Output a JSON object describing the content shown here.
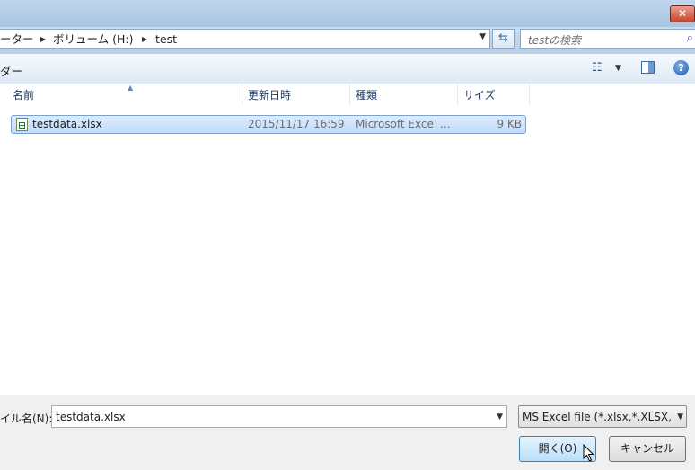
{
  "window": {
    "close_label": "✕"
  },
  "address": {
    "breadcrumbs": [
      "ーター",
      "ボリューム (H:)",
      "test"
    ],
    "search_placeholder": "testの検索"
  },
  "toolbar": {
    "label": "ダー"
  },
  "file_list": {
    "columns": [
      "名前",
      "更新日時",
      "種類",
      "サイズ"
    ],
    "rows": [
      {
        "name": "testdata.xlsx",
        "modified": "2015/11/17 16:59",
        "type": "Microsoft Excel ...",
        "size": "9 KB",
        "icon": "excel-file-icon"
      }
    ]
  },
  "bottom": {
    "filename_label": "イル名(N):",
    "filename_value": "testdata.xlsx",
    "filetype_value": "MS Excel file (*.xlsx,*.XLSX,",
    "open_label": "開く(O)",
    "cancel_label": "キャンセル"
  },
  "colors": {
    "selection": "#c1dcfc",
    "accent": "#3c7fb1"
  }
}
